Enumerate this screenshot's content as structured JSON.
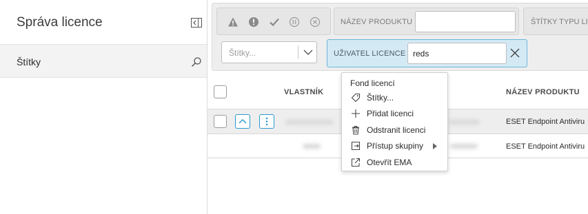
{
  "sidebar": {
    "title": "Správa licence",
    "collapse_icon": "collapse-panel-icon",
    "tags_row_label": "Štítky",
    "search_icon": "search-icon"
  },
  "filters": {
    "severity_icons": [
      "warning-icon",
      "error-icon",
      "check-icon",
      "pause-icon",
      "cancel-icon"
    ],
    "product_name_label": "NÁZEV PRODUKTU",
    "product_name_value": "",
    "license_type_tags_label": "ŠTÍTKY TYPU LIC",
    "tags_placeholder": "Štítky...",
    "license_user_label": "UŽIVATEL LICENCE",
    "license_user_value": "reds"
  },
  "table": {
    "columns": [
      "VLASTNÍK",
      "NÁZEV PRODUKTU"
    ],
    "rows": [
      {
        "product": "ESET Endpoint Antiviru"
      },
      {
        "product": "ESET Endpoint Antiviru"
      }
    ]
  },
  "context_menu": {
    "header": "Fond licencí",
    "items": [
      {
        "label": "Štítky...",
        "icon": "tag-icon"
      },
      {
        "label": "Přidat licenci",
        "icon": "plus-icon"
      },
      {
        "label": "Odstranit licenci",
        "icon": "trash-icon"
      },
      {
        "label": "Přístup skupiny",
        "icon": "group-access-icon",
        "submenu": true
      },
      {
        "label": "Otevřít EMA",
        "icon": "external-link-icon"
      }
    ]
  },
  "colors": {
    "accent": "#2a9ad0",
    "active_filter_bg": "#d3eaf5"
  }
}
